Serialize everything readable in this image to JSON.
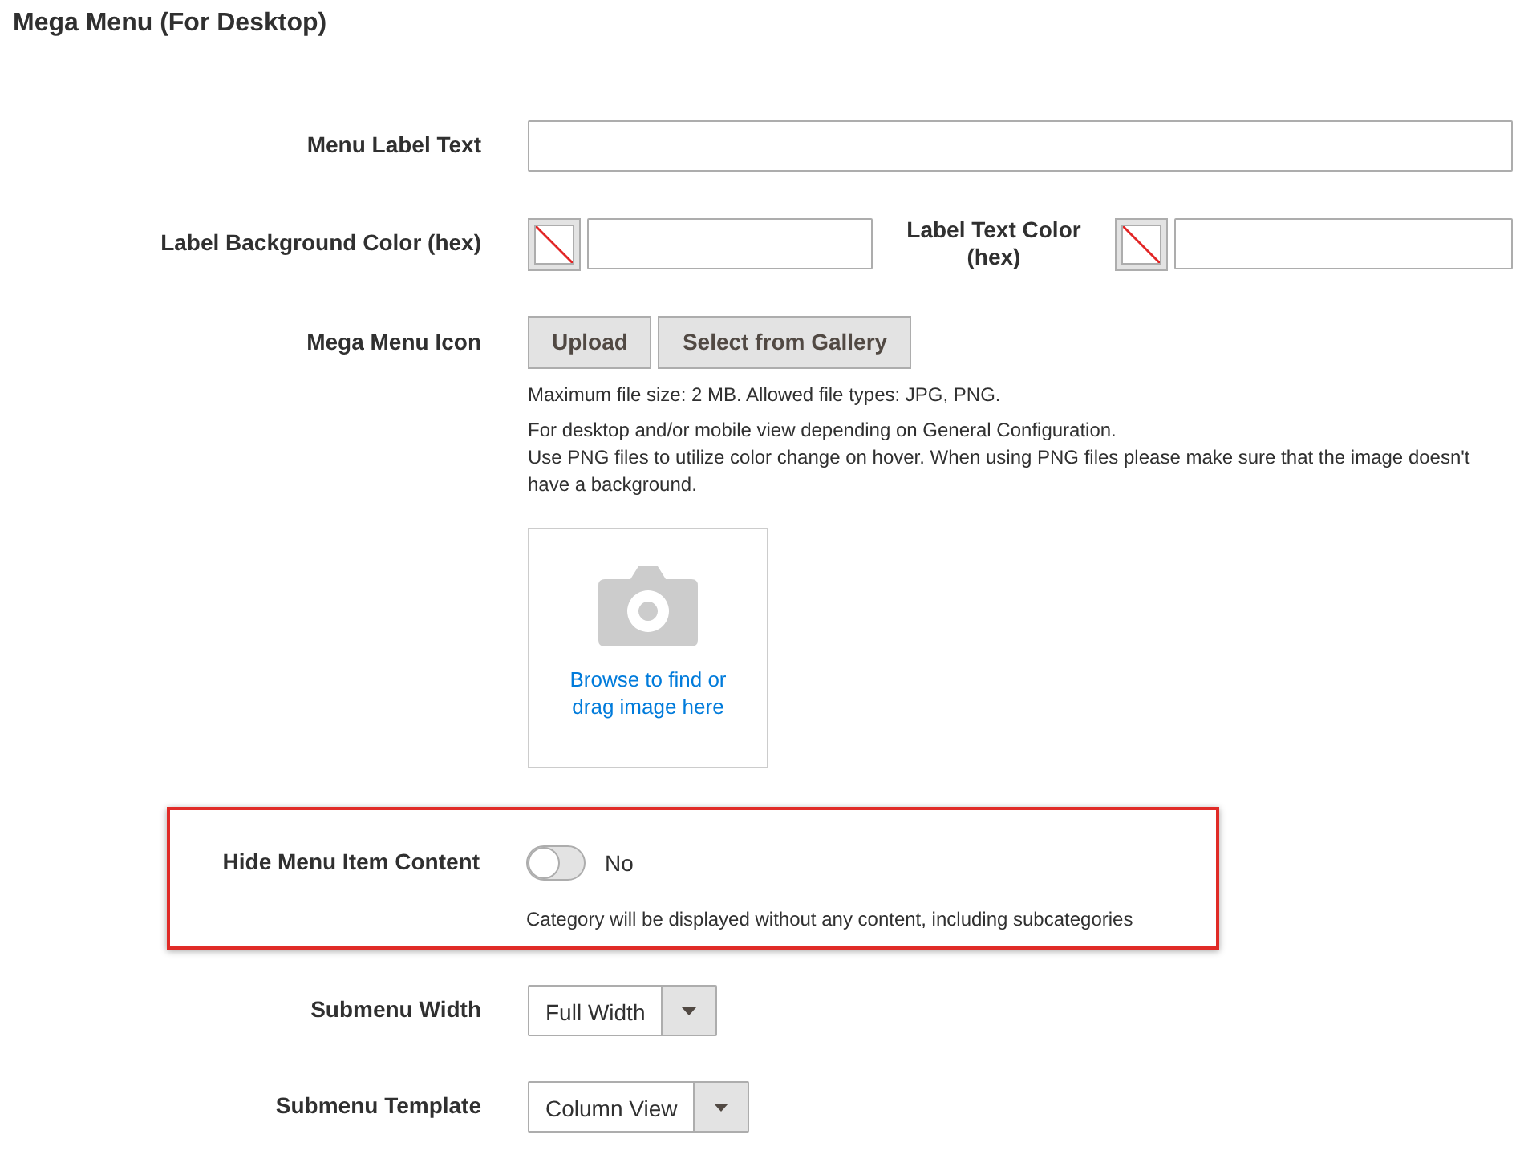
{
  "section_title": "Mega Menu (For Desktop)",
  "fields": [
    {
      "kind": "text",
      "label": "Menu Label Text"
    },
    {
      "kind": "color_pair",
      "label": "Label Background Color (hex)",
      "second_label": "Label Text Color (hex)"
    },
    {
      "kind": "image",
      "label": "Mega Menu Icon",
      "buttons": [
        "Upload",
        "Select from Gallery"
      ],
      "notes": [
        [
          "Maximum file size: 2 MB. Allowed file types: JPG, PNG."
        ],
        [
          "For desktop and/or mobile view depending on General Configuration.",
          "Use PNG files to utilize color change on hover. When using PNG files please make sure that the image doesn't have a background."
        ]
      ],
      "dropzone_text": "Browse to find or drag image here"
    },
    {
      "kind": "toggle",
      "label": "Hide Menu Item Content",
      "on": false,
      "state_text": "No",
      "note": "Category will be displayed without any content, including subcategories",
      "highlighted": true
    },
    {
      "kind": "select",
      "label": "Submenu Width",
      "value": "Full Width"
    },
    {
      "kind": "select",
      "label": "Submenu Template",
      "value": "Column View"
    }
  ]
}
